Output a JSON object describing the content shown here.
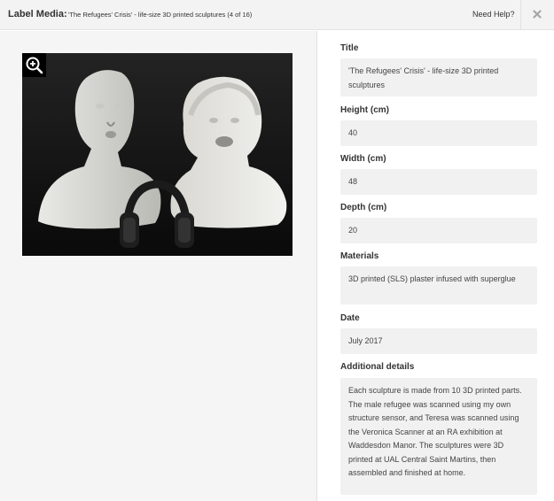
{
  "header": {
    "label": "Label Media:",
    "media_title": "'The Refugees' Crisis' - life-size 3D printed sculptures (4 of 16)",
    "help_label": "Need Help?",
    "close_icon": "close-x-icon"
  },
  "viewer": {
    "zoom_icon": "zoom-in-icon",
    "image_subject": "two white plaster busts and headphones"
  },
  "fields": {
    "title": {
      "label": "Title",
      "value": "'The Refugees' Crisis' - life-size 3D printed sculptures"
    },
    "height": {
      "label": "Height (cm)",
      "value": "40"
    },
    "width": {
      "label": "Width (cm)",
      "value": "48"
    },
    "depth": {
      "label": "Depth (cm)",
      "value": "20"
    },
    "materials": {
      "label": "Materials",
      "value": "3D printed (SLS) plaster infused with superglue"
    },
    "date": {
      "label": "Date",
      "value": "July 2017"
    },
    "details": {
      "label": "Additional details",
      "value": "Each sculpture is made from 10 3D printed parts. The male refugee was scanned using my own structure sensor, and Teresa was scanned using the Veronica Scanner at an RA exhibition at Waddesdon Manor. The sculptures were 3D printed at UAL Central Saint Martins, then assembled and finished at home."
    }
  }
}
